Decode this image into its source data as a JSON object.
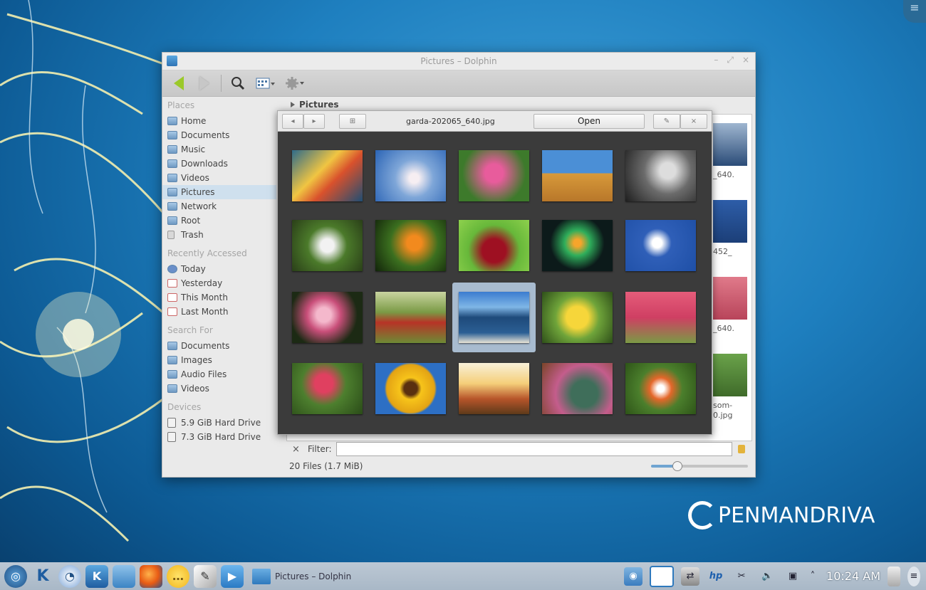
{
  "window": {
    "title": "Pictures – Dolphin",
    "controls": [
      "–",
      "⤢",
      "×"
    ]
  },
  "toolbar": {
    "back": "back-icon",
    "forward": "forward-icon",
    "search": "search-icon",
    "view_mode": "view-mode-icon",
    "settings": "gear-icon"
  },
  "sidebar": {
    "places_title": "Places",
    "places": [
      {
        "label": "Home",
        "icon": "folder"
      },
      {
        "label": "Documents",
        "icon": "folder"
      },
      {
        "label": "Music",
        "icon": "folder"
      },
      {
        "label": "Downloads",
        "icon": "folder"
      },
      {
        "label": "Videos",
        "icon": "folder"
      },
      {
        "label": "Pictures",
        "icon": "folder",
        "active": true
      },
      {
        "label": "Network",
        "icon": "folder"
      },
      {
        "label": "Root",
        "icon": "folder"
      },
      {
        "label": "Trash",
        "icon": "trash"
      }
    ],
    "recent_title": "Recently Accessed",
    "recent": [
      {
        "label": "Today",
        "icon": "today"
      },
      {
        "label": "Yesterday",
        "icon": "calendar"
      },
      {
        "label": "This Month",
        "icon": "calendar"
      },
      {
        "label": "Last Month",
        "icon": "calendar"
      }
    ],
    "search_title": "Search For",
    "search": [
      {
        "label": "Documents",
        "icon": "folder"
      },
      {
        "label": "Images",
        "icon": "folder"
      },
      {
        "label": "Audio Files",
        "icon": "folder"
      },
      {
        "label": "Videos",
        "icon": "folder"
      }
    ],
    "devices_title": "Devices",
    "devices": [
      {
        "label": "5.9 GiB Hard Drive",
        "icon": "drive"
      },
      {
        "label": "7.3 GiB Hard Drive",
        "icon": "drive"
      }
    ]
  },
  "breadcrumb": {
    "label": "Pictures"
  },
  "background_labels": [
    "_640.",
    "452_",
    "_640.",
    "som-",
    "0.jpg"
  ],
  "preview": {
    "prev": "◂",
    "next": "▸",
    "grid_toggle": "⊞",
    "filename": "garda-202065_640.jpg",
    "open_label": "Open",
    "pin": "✎",
    "close": "×"
  },
  "filter": {
    "label": "Filter:",
    "value": "",
    "clear": "×"
  },
  "status": {
    "text": "20 Files (1.7 MiB)",
    "zoom_fraction": 0.27
  },
  "brand": {
    "text": "PENMANDRIVA"
  },
  "taskbar": {
    "task_label": "Pictures – Dolphin",
    "clock": "10:24 AM",
    "tray_hp": "hp"
  },
  "colors": {
    "accent": "#2e79bd",
    "selection": "#cfe0ee",
    "preview_bg": "#3b3b3b"
  }
}
